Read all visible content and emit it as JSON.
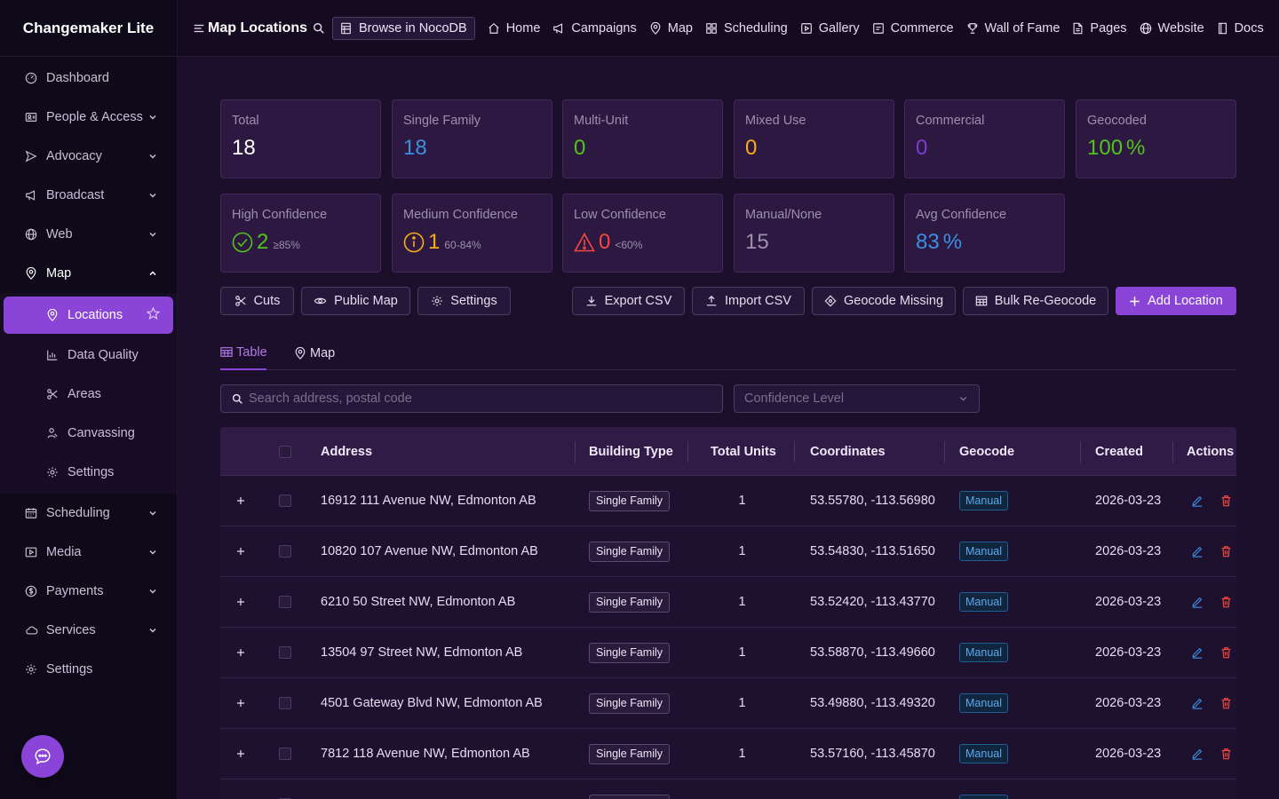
{
  "app": {
    "brand": "Changemaker Lite"
  },
  "sidebar": {
    "items": [
      {
        "label": "Dashboard",
        "icon": "dashboard-icon",
        "chevron": false
      },
      {
        "label": "People & Access",
        "icon": "people-icon",
        "chevron": true
      },
      {
        "label": "Advocacy",
        "icon": "send-icon",
        "chevron": true
      },
      {
        "label": "Broadcast",
        "icon": "megaphone-icon",
        "chevron": true
      },
      {
        "label": "Web",
        "icon": "globe-icon",
        "chevron": true
      },
      {
        "label": "Map",
        "icon": "map-pin-icon",
        "chevron": true,
        "expanded": true
      }
    ],
    "map_submenu": [
      {
        "label": "Locations",
        "icon": "map-pin-icon",
        "active": true
      },
      {
        "label": "Data Quality",
        "icon": "bar-chart-icon"
      },
      {
        "label": "Areas",
        "icon": "scissors-icon"
      },
      {
        "label": "Canvassing",
        "icon": "user-walk-icon"
      },
      {
        "label": "Settings",
        "icon": "gear-icon"
      }
    ],
    "items_after": [
      {
        "label": "Scheduling",
        "icon": "calendar-icon",
        "chevron": true
      },
      {
        "label": "Media",
        "icon": "video-icon",
        "chevron": true
      },
      {
        "label": "Payments",
        "icon": "dollar-icon",
        "chevron": true
      },
      {
        "label": "Services",
        "icon": "cloud-icon",
        "chevron": true
      },
      {
        "label": "Settings",
        "icon": "gear-icon",
        "chevron": false
      }
    ]
  },
  "topbar": {
    "title": "Map Locations",
    "nocodb_label": "Browse in NocoDB",
    "links": [
      {
        "label": "Home",
        "icon": "home-icon"
      },
      {
        "label": "Campaigns",
        "icon": "megaphone-icon"
      },
      {
        "label": "Map",
        "icon": "map-pin-icon"
      },
      {
        "label": "Scheduling",
        "icon": "grid-icon"
      },
      {
        "label": "Gallery",
        "icon": "play-square-icon"
      },
      {
        "label": "Commerce",
        "icon": "shop-icon"
      },
      {
        "label": "Wall of Fame",
        "icon": "trophy-icon"
      },
      {
        "label": "Pages",
        "icon": "file-icon"
      },
      {
        "label": "Website",
        "icon": "globe-icon"
      },
      {
        "label": "Docs",
        "icon": "book-icon"
      }
    ]
  },
  "stats": {
    "total": {
      "label": "Total",
      "value": "18"
    },
    "single_family": {
      "label": "Single Family",
      "value": "18"
    },
    "multi_unit": {
      "label": "Multi-Unit",
      "value": "0"
    },
    "mixed_use": {
      "label": "Mixed Use",
      "value": "0"
    },
    "commercial": {
      "label": "Commercial",
      "value": "0"
    },
    "geocoded": {
      "label": "Geocoded",
      "value": "100",
      "unit": "%"
    },
    "high_conf": {
      "label": "High Confidence",
      "value": "2",
      "sub": "≥85%"
    },
    "medium_conf": {
      "label": "Medium Confidence",
      "value": "1",
      "sub": "60-84%"
    },
    "low_conf": {
      "label": "Low Confidence",
      "value": "0",
      "sub": "<60%"
    },
    "manual": {
      "label": "Manual/None",
      "value": "15"
    },
    "avg_conf": {
      "label": "Avg Confidence",
      "value": "83",
      "unit": "%"
    }
  },
  "toolbar": {
    "cuts": "Cuts",
    "public_map": "Public Map",
    "settings": "Settings",
    "export_csv": "Export CSV",
    "import_csv": "Import CSV",
    "geocode_missing": "Geocode Missing",
    "bulk_regeocode": "Bulk Re-Geocode",
    "add_location": "Add Location"
  },
  "tabs": {
    "table": "Table",
    "map": "Map"
  },
  "filters": {
    "search_placeholder": "Search address, postal code",
    "confidence_placeholder": "Confidence Level"
  },
  "table": {
    "columns": {
      "address": "Address",
      "building_type": "Building Type",
      "total_units": "Total Units",
      "coordinates": "Coordinates",
      "geocode": "Geocode",
      "created": "Created",
      "actions": "Actions"
    },
    "rows": [
      {
        "address": "16912 111 Avenue NW, Edmonton AB",
        "type": "Single Family",
        "units": "1",
        "coords": "53.55780, -113.56980",
        "geocode": "Manual",
        "created": "2026-03-23"
      },
      {
        "address": "10820 107 Avenue NW, Edmonton AB",
        "type": "Single Family",
        "units": "1",
        "coords": "53.54830, -113.51650",
        "geocode": "Manual",
        "created": "2026-03-23"
      },
      {
        "address": "6210 50 Street NW, Edmonton AB",
        "type": "Single Family",
        "units": "1",
        "coords": "53.52420, -113.43770",
        "geocode": "Manual",
        "created": "2026-03-23"
      },
      {
        "address": "13504 97 Street NW, Edmonton AB",
        "type": "Single Family",
        "units": "1",
        "coords": "53.58870, -113.49660",
        "geocode": "Manual",
        "created": "2026-03-23"
      },
      {
        "address": "4501 Gateway Blvd NW, Edmonton AB",
        "type": "Single Family",
        "units": "1",
        "coords": "53.49880, -113.49320",
        "geocode": "Manual",
        "created": "2026-03-23"
      },
      {
        "address": "7812 118 Avenue NW, Edmonton AB",
        "type": "Single Family",
        "units": "1",
        "coords": "53.57160, -113.45870",
        "geocode": "Manual",
        "created": "2026-03-23"
      },
      {
        "address": "",
        "type": "Single Family",
        "units": "",
        "coords": "",
        "geocode": "Manual",
        "created": ""
      }
    ]
  },
  "colors": {
    "accent": "#8a45d8",
    "blue": "#3d8fe0",
    "green": "#52c41a",
    "orange": "#faad14",
    "purple": "#7a3ed0",
    "red": "#f5483f"
  }
}
